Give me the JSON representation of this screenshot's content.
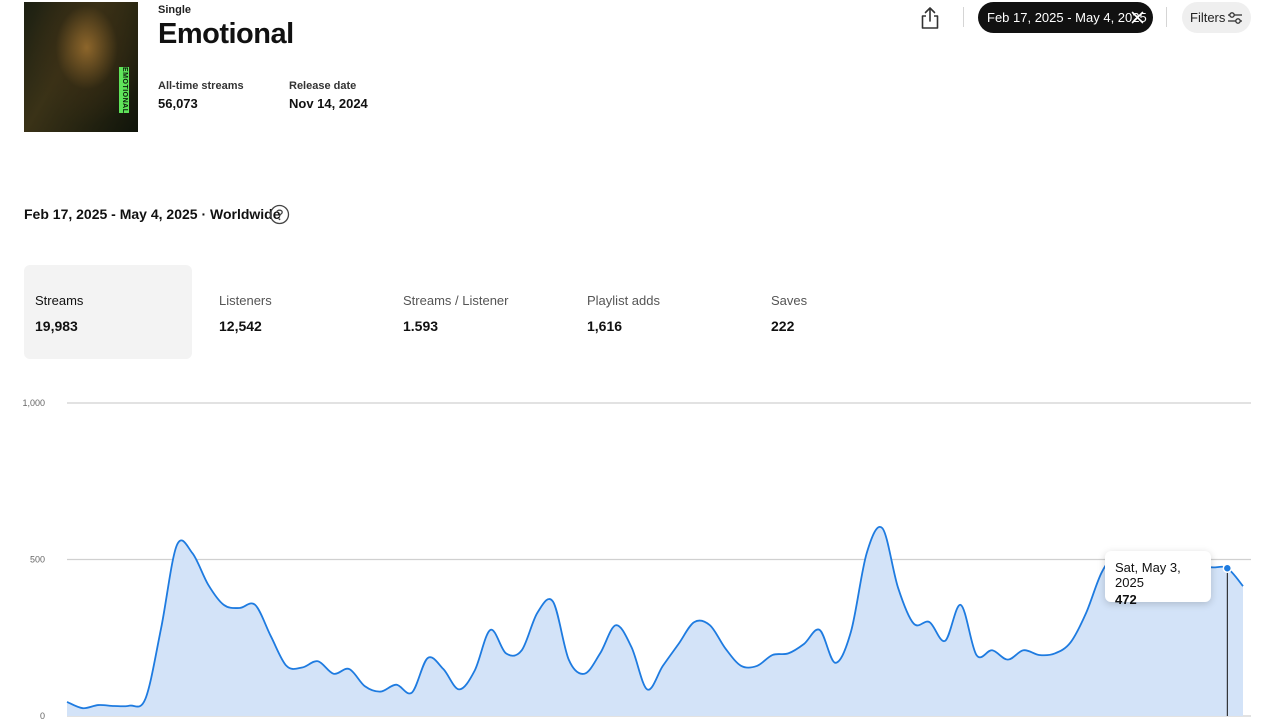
{
  "release": {
    "type_label": "Single",
    "title": "Emotional",
    "cover_text": "EMOTIONAL",
    "all_time_streams_label": "All-time streams",
    "all_time_streams": "56,073",
    "release_date_label": "Release date",
    "release_date": "Nov 14, 2024"
  },
  "toolbar": {
    "share_icon": "share-icon",
    "date_chip_label": "Feb 17, 2025 - May 4, 2025",
    "filters_label": "Filters"
  },
  "range_heading": "Feb 17, 2025 - May 4, 2025 · Worldwide",
  "metrics": [
    {
      "label": "Streams",
      "value": "19,983",
      "active": true
    },
    {
      "label": "Listeners",
      "value": "12,542",
      "active": false
    },
    {
      "label": "Streams / Listener",
      "value": "1.593",
      "active": false
    },
    {
      "label": "Playlist adds",
      "value": "1,616",
      "active": false
    },
    {
      "label": "Saves",
      "value": "222",
      "active": false
    }
  ],
  "colors": {
    "line": "#1e7be0",
    "fill": "#d3e3f8",
    "grid": "#d0d0d0",
    "accent_dark": "#111111"
  },
  "chart_data": {
    "type": "area",
    "ylim": [
      0,
      1000
    ],
    "yticks": [
      "0",
      "500",
      "1,000"
    ],
    "x_start": "2025-02-17",
    "x_end": "2025-05-04",
    "series": [
      {
        "values": [
          45,
          25,
          35,
          32,
          33,
          55,
          280,
          545,
          520,
          420,
          355,
          345,
          355,
          255,
          160,
          155,
          175,
          135,
          150,
          95,
          78,
          100,
          75,
          185,
          150,
          85,
          145,
          275,
          200,
          210,
          330,
          365,
          180,
          135,
          200,
          290,
          220,
          85,
          160,
          230,
          300,
          290,
          215,
          160,
          160,
          195,
          200,
          230,
          275,
          170,
          270,
          520,
          600,
          410,
          295,
          300,
          240,
          355,
          195,
          210,
          180,
          210,
          195,
          200,
          235,
          330,
          460,
          520,
          505,
          495,
          505,
          510,
          485,
          475,
          472,
          415
        ]
      }
    ],
    "tooltip": {
      "date": "Sat, May 3, 2025",
      "value": "472"
    }
  }
}
